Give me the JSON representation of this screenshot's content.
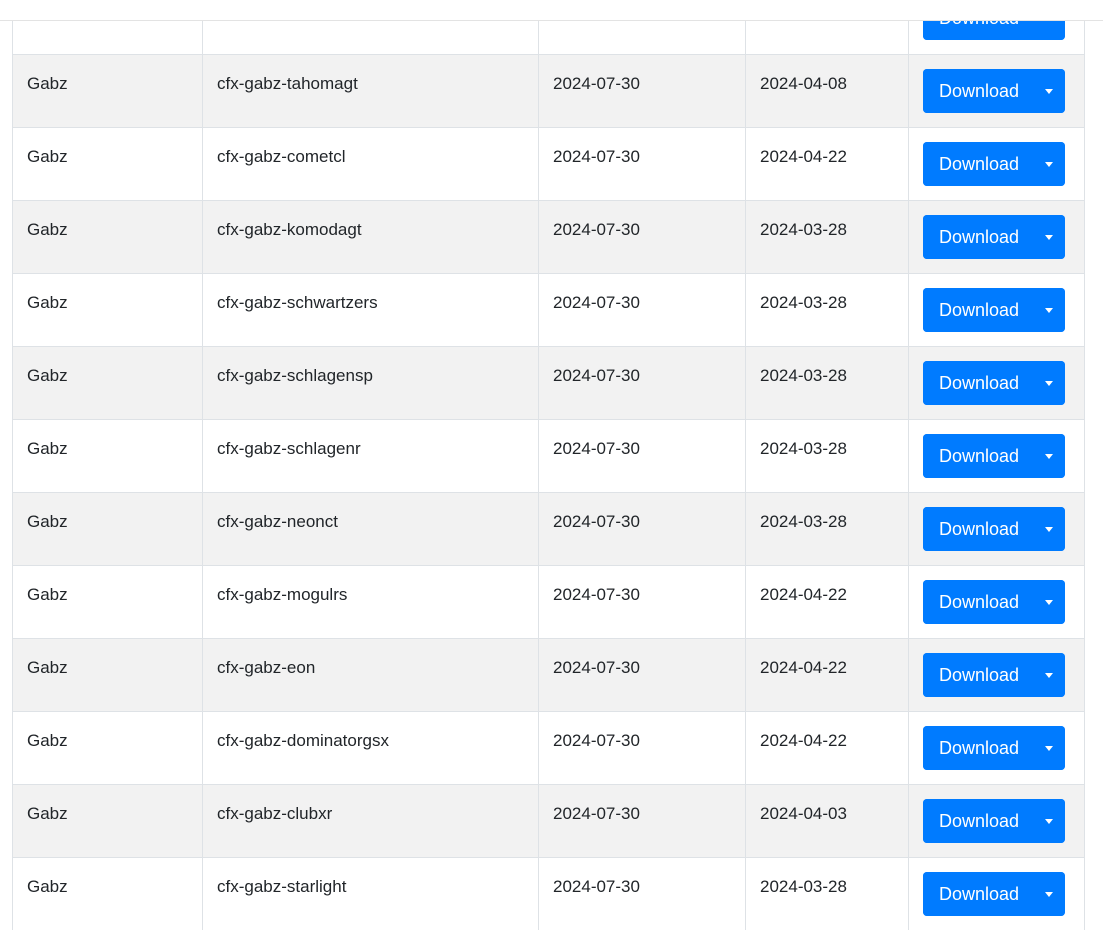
{
  "table": {
    "button_label": "Download",
    "rows": [
      {
        "author": "",
        "name": "",
        "date1": "",
        "date2": ""
      },
      {
        "author": "Gabz",
        "name": "cfx-gabz-tahomagt",
        "date1": "2024-07-30",
        "date2": "2024-04-08"
      },
      {
        "author": "Gabz",
        "name": "cfx-gabz-cometcl",
        "date1": "2024-07-30",
        "date2": "2024-04-22"
      },
      {
        "author": "Gabz",
        "name": "cfx-gabz-komodagt",
        "date1": "2024-07-30",
        "date2": "2024-03-28"
      },
      {
        "author": "Gabz",
        "name": "cfx-gabz-schwartzers",
        "date1": "2024-07-30",
        "date2": "2024-03-28"
      },
      {
        "author": "Gabz",
        "name": "cfx-gabz-schlagensp",
        "date1": "2024-07-30",
        "date2": "2024-03-28"
      },
      {
        "author": "Gabz",
        "name": "cfx-gabz-schlagenr",
        "date1": "2024-07-30",
        "date2": "2024-03-28"
      },
      {
        "author": "Gabz",
        "name": "cfx-gabz-neonct",
        "date1": "2024-07-30",
        "date2": "2024-03-28"
      },
      {
        "author": "Gabz",
        "name": "cfx-gabz-mogulrs",
        "date1": "2024-07-30",
        "date2": "2024-04-22"
      },
      {
        "author": "Gabz",
        "name": "cfx-gabz-eon",
        "date1": "2024-07-30",
        "date2": "2024-04-22"
      },
      {
        "author": "Gabz",
        "name": "cfx-gabz-dominatorgsx",
        "date1": "2024-07-30",
        "date2": "2024-04-22"
      },
      {
        "author": "Gabz",
        "name": "cfx-gabz-clubxr",
        "date1": "2024-07-30",
        "date2": "2024-04-03"
      },
      {
        "author": "Gabz",
        "name": "cfx-gabz-starlight",
        "date1": "2024-07-30",
        "date2": "2024-03-28"
      }
    ]
  },
  "colors": {
    "button": "#007bff",
    "row_stripe": "#f2f2f2",
    "border": "#dee2e6"
  },
  "icons": {
    "dropdown": "caret-down-icon"
  }
}
